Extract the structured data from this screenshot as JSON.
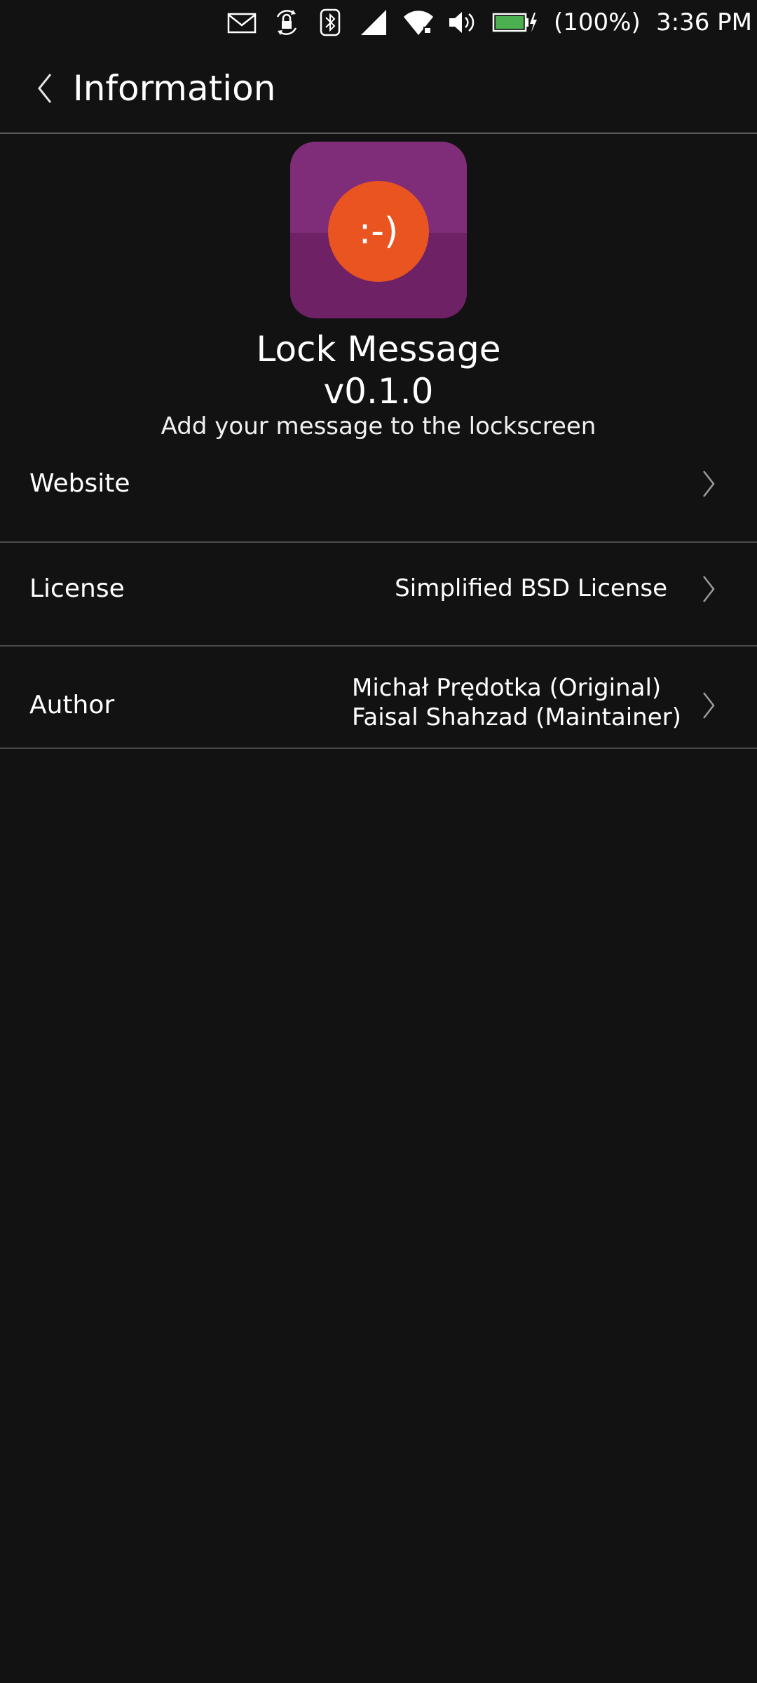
{
  "status_bar": {
    "icons": [
      "mail-icon",
      "rotation-lock-icon",
      "bluetooth-icon",
      "cellular-signal-icon",
      "wifi-icon",
      "volume-icon",
      "battery-charging-icon"
    ],
    "battery_percent": "(100%)",
    "time": "3:36 PM",
    "battery_color": "#4caf50"
  },
  "header": {
    "title": "Information"
  },
  "app": {
    "icon_face": ":-)",
    "name": "Lock Message",
    "version": "v0.1.0",
    "description": "Add your message to the lockscreen",
    "icon_colors": {
      "tile_top": "#7f2d79",
      "tile_bottom": "#6e2165",
      "circle": "#e95420"
    }
  },
  "rows": [
    {
      "label": "Website",
      "value": ""
    },
    {
      "label": "License",
      "value": "Simplified BSD License"
    },
    {
      "label": "Author",
      "value_lines": [
        "Michał Prędotka (Original)",
        "Faisal Shahzad (Maintainer)"
      ]
    }
  ]
}
